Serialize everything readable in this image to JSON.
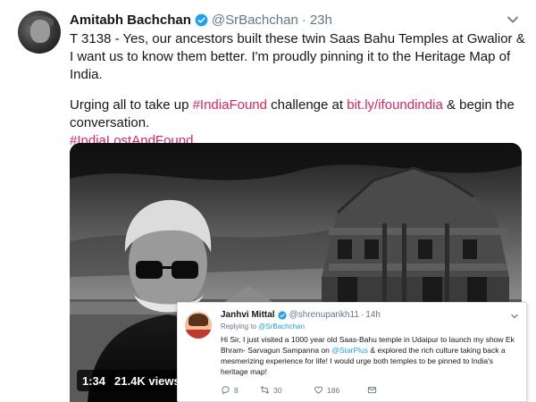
{
  "tweet": {
    "author_name": "Amitabh Bachchan",
    "handle": "@SrBachchan",
    "separator": "·",
    "time": "23h",
    "text_line1": "T 3138 - Yes, our ancestors built these twin Saas Bahu Temples at Gwalior & I want us to know them better. I'm proudly pinning it to the Heritage Map of India.",
    "text_line2_prefix": "Urging all to take up ",
    "hashtag_found": "#IndiaFound",
    "text_line2_middle": " challenge at ",
    "link": "bit.ly/ifoundindia",
    "text_line2_suffix": " & begin the conversation.",
    "hashtag_lost": "#IndiaLostAndFound",
    "link_color": "#e0245e"
  },
  "video": {
    "duration": "1:34",
    "views": "21.4K views"
  },
  "reply": {
    "author_name": "Janhvi Mittal",
    "handle": "@shrenuparikh11",
    "separator": "·",
    "time": "14h",
    "replying_label": "Replying to ",
    "replying_to": "@SrBachchan",
    "text_before": "Hi Sir, I just visited a 1000 year old Saas-Bahu temple in Udaipur to launch my show Ek Bhram- Sarvagun Sampanna on ",
    "mention": "@StarPlus",
    "text_after": " & explored the rich culture taking back a mesmerizing experience for life! I would urge both temples to be pinned to India's heritage map!",
    "reply_count": "8",
    "retweet_count": "30",
    "like_count": "186",
    "mention_color": "#1da1f2"
  },
  "icons": {
    "verified": "verified-badge-icon",
    "caret": "chevron-down-icon",
    "reply": "reply-icon",
    "retweet": "retweet-icon",
    "like": "heart-icon",
    "message": "mail-icon"
  }
}
